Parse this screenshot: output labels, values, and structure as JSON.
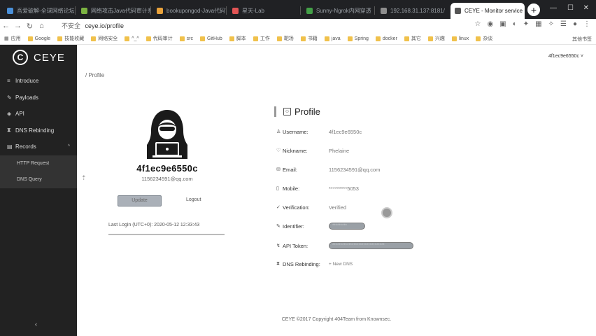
{
  "browser": {
    "tabs": [
      {
        "label": "吾爱破解-全球网络论坛",
        "active": false,
        "color": "#4a90d9"
      },
      {
        "label": "网络攻击Java代码审计系统",
        "active": false,
        "color": "#7cb342"
      },
      {
        "label": "bookupongod-Java代码审计",
        "active": false,
        "color": "#e9a23b"
      },
      {
        "label": "星天-Lab",
        "active": false,
        "color": "#e25555"
      },
      {
        "label": "Sunny-Ngrok内网穿透",
        "active": false,
        "color": "#43a047"
      },
      {
        "label": "192.168.31.137:8181/",
        "active": false,
        "color": "#8e8e8e"
      },
      {
        "label": "CEYE - Monitor service",
        "active": true,
        "color": "#555555"
      }
    ],
    "url": "ceye.io/profile",
    "insecure_label": "不安全",
    "bookmarks": [
      "应用",
      "Google",
      "技能收藏",
      "网络安全",
      "^_^",
      "代码审计",
      "src",
      "GitHub",
      "脚本",
      "工作",
      "靶场",
      "书籍",
      "java",
      "Spring",
      "docker",
      "其它",
      "兴趣",
      "linux",
      "杂谈"
    ],
    "bookmarks_right": "其他书签"
  },
  "sidebar": {
    "logo_letter": "C",
    "logo_text": "CEYE",
    "items": [
      {
        "label": "Introduce",
        "icon": "≡"
      },
      {
        "label": "Payloads",
        "icon": "✎"
      },
      {
        "label": "API",
        "icon": "◈"
      },
      {
        "label": "DNS Rebinding",
        "icon": "⧗"
      },
      {
        "label": "Records",
        "icon": "▤"
      }
    ],
    "subitems": [
      "HTTP Request",
      "DNS Query"
    ],
    "collapse_glyph": "‹"
  },
  "main": {
    "breadcrumb_sep": "/",
    "breadcrumb": "Profile",
    "account": "4f1ec9e6550c",
    "username": "4f1ec9e6550c",
    "email": "1156234591@qq.com",
    "update_label": "Update",
    "logout_label": "Logout",
    "last_login": "Last Login (UTC+0): 2020-05-12 12:33:43",
    "profile_title": "Profile",
    "fields": [
      {
        "icon": "♙",
        "label": "Username:",
        "value": "4f1ec9e6550c",
        "pill": false
      },
      {
        "icon": "♡",
        "label": "Nickname:",
        "value": "Phelaine",
        "pill": false
      },
      {
        "icon": "✉",
        "label": "Email:",
        "value": "1156234591@qq.com",
        "pill": false
      },
      {
        "icon": "▯",
        "label": "Mobile:",
        "value": "*********5053",
        "pill": false
      },
      {
        "icon": "✓",
        "label": "Verification:",
        "value": "Verified",
        "pill": false
      },
      {
        "icon": "✎",
        "label": "Identifier:",
        "value": "*********",
        "pill": true
      },
      {
        "icon": "↯",
        "label": "API Token:",
        "value": "********************************",
        "pill": true
      },
      {
        "icon": "⧗",
        "label": "DNS Rebinding:",
        "value": "+ New DNS",
        "pill": false
      }
    ],
    "footer": "CEYE ©2017 Copyright 404Team from Knownsec."
  }
}
